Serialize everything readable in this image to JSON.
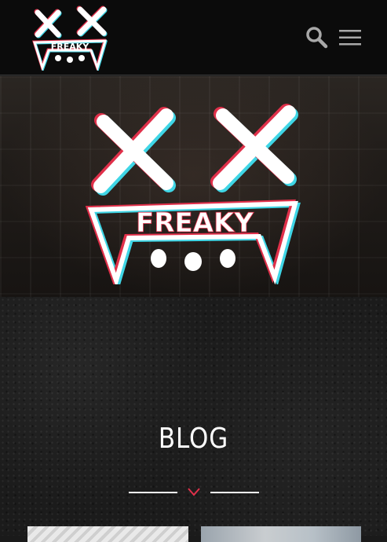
{
  "header": {
    "logo_icon": "freaky-logo-icon",
    "search_icon": "search-icon",
    "menu_icon": "hamburger-menu-icon"
  },
  "hero": {
    "logo_icon": "freaky-logo-large-icon",
    "logo_text": "FREAKY"
  },
  "blog": {
    "title": "BLOG",
    "chevron_icon": "chevron-down-icon",
    "cards": [
      {
        "name": "blog-card-1"
      },
      {
        "name": "blog-card-2"
      }
    ]
  },
  "colors": {
    "header_bg": "#0b0b0b",
    "accent_cyan": "#3fd6e6",
    "accent_red": "#e0304a",
    "text": "#ffffff"
  }
}
